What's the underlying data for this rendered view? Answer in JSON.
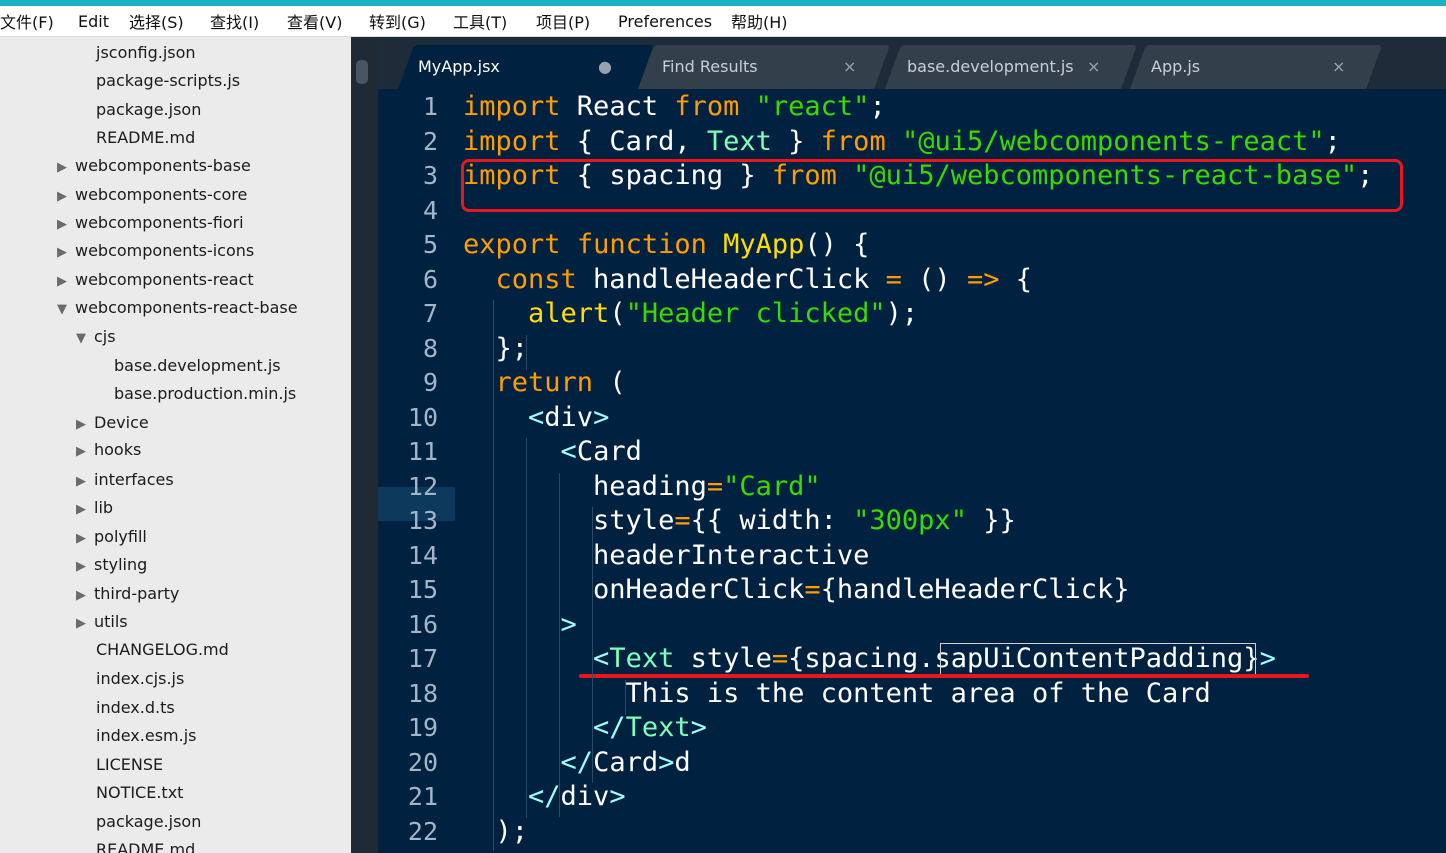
{
  "menubar": {
    "items": [
      "文件(F)",
      "Edit",
      "选择(S)",
      "查找(I)",
      "查看(V)",
      "转到(G)",
      "工具(T)",
      "项目(P)",
      "Preferences",
      "帮助(H)"
    ]
  },
  "sidebar": {
    "items": [
      {
        "label": "jsconfig.json",
        "type": "file"
      },
      {
        "label": "package-scripts.js",
        "type": "file"
      },
      {
        "label": "package.json",
        "type": "file"
      },
      {
        "label": "README.md",
        "type": "file"
      },
      {
        "label": "webcomponents-base",
        "type": "folder-collapsed"
      },
      {
        "label": "webcomponents-core",
        "type": "folder-collapsed"
      },
      {
        "label": "webcomponents-fiori",
        "type": "folder-collapsed"
      },
      {
        "label": "webcomponents-icons",
        "type": "folder-collapsed"
      },
      {
        "label": "webcomponents-react",
        "type": "folder-collapsed"
      },
      {
        "label": "webcomponents-react-base",
        "type": "folder-expanded"
      },
      {
        "label": "cjs",
        "type": "folder-expanded"
      },
      {
        "label": "base.development.js",
        "type": "file"
      },
      {
        "label": "base.production.min.js",
        "type": "file"
      },
      {
        "label": "Device",
        "type": "folder-collapsed"
      },
      {
        "label": "hooks",
        "type": "folder-collapsed"
      },
      {
        "label": "interfaces",
        "type": "folder-collapsed"
      },
      {
        "label": "lib",
        "type": "folder-collapsed"
      },
      {
        "label": "polyfill",
        "type": "folder-collapsed"
      },
      {
        "label": "styling",
        "type": "folder-collapsed"
      },
      {
        "label": "third-party",
        "type": "folder-collapsed"
      },
      {
        "label": "utils",
        "type": "folder-collapsed"
      },
      {
        "label": "CHANGELOG.md",
        "type": "file"
      },
      {
        "label": "index.cjs.js",
        "type": "file"
      },
      {
        "label": "index.d.ts",
        "type": "file"
      },
      {
        "label": "index.esm.js",
        "type": "file"
      },
      {
        "label": "LICENSE",
        "type": "file"
      },
      {
        "label": "NOTICE.txt",
        "type": "file"
      },
      {
        "label": "package.json",
        "type": "file"
      },
      {
        "label": "README.md",
        "type": "file"
      }
    ],
    "arrow_collapsed": "▶",
    "arrow_expanded": "▼"
  },
  "tabs": [
    {
      "label": "MyApp.jsx",
      "close": "●",
      "active": true
    },
    {
      "label": "Find Results",
      "close": "×",
      "active": false
    },
    {
      "label": "base.development.js",
      "close": "×",
      "active": false
    },
    {
      "label": "App.js",
      "close": "×",
      "active": false
    }
  ],
  "editor": {
    "active_line": 11,
    "line_numbers": [
      "1",
      "2",
      "3",
      "4",
      "5",
      "6",
      "7",
      "8",
      "9",
      "10",
      "11",
      "12",
      "13",
      "14",
      "15",
      "16",
      "17",
      "18",
      "19",
      "20",
      "21",
      "22"
    ],
    "lines": [
      [
        [
          "kw",
          "import"
        ],
        [
          "plain",
          " React "
        ],
        [
          "kw",
          "from"
        ],
        [
          "plain",
          " "
        ],
        [
          "str",
          "\"react\""
        ],
        [
          "plain",
          ";"
        ]
      ],
      [
        [
          "kw",
          "import"
        ],
        [
          "plain",
          " { Card, "
        ],
        [
          "cls",
          "Text"
        ],
        [
          "plain",
          " } "
        ],
        [
          "kw",
          "from"
        ],
        [
          "plain",
          " "
        ],
        [
          "str",
          "\"@ui5/webcomponents-react\""
        ],
        [
          "plain",
          ";"
        ]
      ],
      [
        [
          "kw",
          "import"
        ],
        [
          "plain",
          " { spacing } "
        ],
        [
          "kw",
          "from"
        ],
        [
          "plain",
          " "
        ],
        [
          "str",
          "\"@ui5/webcomponents-react-base\""
        ],
        [
          "plain",
          ";"
        ]
      ],
      [],
      [
        [
          "kw",
          "export"
        ],
        [
          "plain",
          " "
        ],
        [
          "kw",
          "function"
        ],
        [
          "plain",
          " "
        ],
        [
          "fn",
          "MyApp"
        ],
        [
          "plain",
          "() {"
        ]
      ],
      [
        [
          "plain",
          "  "
        ],
        [
          "kw",
          "const"
        ],
        [
          "plain",
          " handleHeaderClick "
        ],
        [
          "op",
          "="
        ],
        [
          "plain",
          " () "
        ],
        [
          "op",
          "=>"
        ],
        [
          "plain",
          " {"
        ]
      ],
      [
        [
          "plain",
          "    "
        ],
        [
          "fn",
          "alert"
        ],
        [
          "plain",
          "("
        ],
        [
          "str",
          "\"Header clicked\""
        ],
        [
          "plain",
          ");"
        ]
      ],
      [
        [
          "plain",
          "  };"
        ]
      ],
      [
        [
          "plain",
          "  "
        ],
        [
          "kw",
          "return"
        ],
        [
          "plain",
          " ("
        ]
      ],
      [
        [
          "plain",
          "    "
        ],
        [
          "tag",
          "<"
        ],
        [
          "plain",
          "div"
        ],
        [
          "tag",
          ">"
        ]
      ],
      [
        [
          "plain",
          "      "
        ],
        [
          "tag",
          "<"
        ],
        [
          "plain",
          "Card"
        ]
      ],
      [
        [
          "plain",
          "        heading"
        ],
        [
          "op",
          "="
        ],
        [
          "str",
          "\"Card\""
        ]
      ],
      [
        [
          "plain",
          "        style"
        ],
        [
          "op",
          "="
        ],
        [
          "plain",
          "{{ width: "
        ],
        [
          "str",
          "\"300px\""
        ],
        [
          "plain",
          " }}"
        ]
      ],
      [
        [
          "plain",
          "        headerInteractive"
        ]
      ],
      [
        [
          "plain",
          "        onHeaderClick"
        ],
        [
          "op",
          "="
        ],
        [
          "plain",
          "{handleHeaderClick}"
        ]
      ],
      [
        [
          "plain",
          "      "
        ],
        [
          "tag",
          ">"
        ]
      ],
      [
        [
          "plain",
          "        "
        ],
        [
          "tag",
          "<"
        ],
        [
          "cls",
          "Text"
        ],
        [
          "plain",
          " style"
        ],
        [
          "op",
          "="
        ],
        [
          "plain",
          "{spacing.sapUiContentPadding}"
        ],
        [
          "tag",
          ">"
        ]
      ],
      [
        [
          "plain",
          "          This is the content area of the Card"
        ]
      ],
      [
        [
          "plain",
          "        "
        ],
        [
          "tag",
          "</"
        ],
        [
          "cls",
          "Text"
        ],
        [
          "tag",
          ">"
        ]
      ],
      [
        [
          "plain",
          "      "
        ],
        [
          "tag",
          "</"
        ],
        [
          "plain",
          "Card"
        ],
        [
          "tag",
          ">"
        ],
        [
          "plain",
          "d"
        ]
      ],
      [
        [
          "plain",
          "    "
        ],
        [
          "tag",
          "</"
        ],
        [
          "plain",
          "div"
        ],
        [
          "tag",
          ">"
        ]
      ],
      [
        [
          "plain",
          "  );"
        ]
      ]
    ]
  },
  "colors": {
    "accent_strip": "#19b0c4",
    "editor_bg": "#002240",
    "keyword": "#ff9d00",
    "string": "#3ad900",
    "function": "#ffdd00",
    "annotation_red": "#e8161d"
  }
}
